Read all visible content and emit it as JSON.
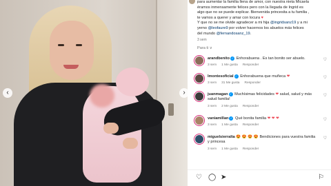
{
  "post": {
    "caption": {
      "line1_prefix": "para aumentar la familia llena de amor, con nuestra nieta Micaela",
      "line2": "éramos inmensamente felices pero con la llegada de Ingrid es",
      "line3": "algo que no se puede explicar. Bienvenida princesita a tu familia ,",
      "line4_prefix": "te vamos a querer y amar con locura",
      "line4_emoji": "♥",
      "line5": "Y que no se me olvide agradecer a mi hija",
      "mention_daughter": "@ingridsanz19",
      "line5_suffix": "y a mi",
      "line6_prefix": "yerno",
      "mention_son_in_law": "@leofaure9",
      "line6_suffix": "por volver hacernos los abuelos más felices",
      "line7_prefix": "del mundo",
      "mention_husband": "@fernandosanz_19",
      "line7_suffix": ".",
      "time": "3 sem"
    },
    "hidden_replies": "Para ti ∨",
    "comments": [
      {
        "user": "arandbenito",
        "verified": true,
        "text": "Enhorabuena . Es tan bonito ser abuelo.",
        "time": "3 sem",
        "likes": "1 Me gusta",
        "reply": "Responder",
        "avatar_color": "#8a6d5a"
      },
      {
        "user": "lmontesoficial",
        "verified": true,
        "text": "Enhorabuena que muñeca",
        "emoji": "❤",
        "time": "3 sem",
        "likes": "31 Me gusta",
        "reply": "Responder",
        "avatar_color": "#5b4a44"
      },
      {
        "user": "juanmagan",
        "verified": true,
        "text": "Muchísimas felicidades",
        "emoji": "❤",
        "text2": "salud, salud y más salud familia!",
        "time": "3 sem",
        "likes": "2 Me gusta",
        "reply": "Responder",
        "avatar_color": "#3c3a3a"
      },
      {
        "user": "vaniamillan",
        "verified": true,
        "text": "Qué bonita familia",
        "emoji": "❤ ❤ ❤",
        "time": "3 sem",
        "likes": "1 Me gusta",
        "reply": "Responder",
        "avatar_color": "#a98368"
      },
      {
        "user": "miguelsierralta",
        "verified": false,
        "prefix_emoji": "😍 😍 😍 😍",
        "text": "Bendiciones para vuestra familia y princesa",
        "time": "3 sem",
        "likes": "1 Me gusta",
        "reply": "Responder",
        "avatar_color": "#2f4f6a"
      }
    ]
  },
  "icons": {
    "like": "heart-outline-icon",
    "comment": "comment-icon",
    "share": "send-icon",
    "save": "bookmark-icon",
    "prev": "chevron-left-icon",
    "next": "chevron-right-icon"
  },
  "colors": {
    "mention": "#00376b",
    "meta": "#737373",
    "heart_red": "#ed4956",
    "verified": "#0095f6"
  }
}
